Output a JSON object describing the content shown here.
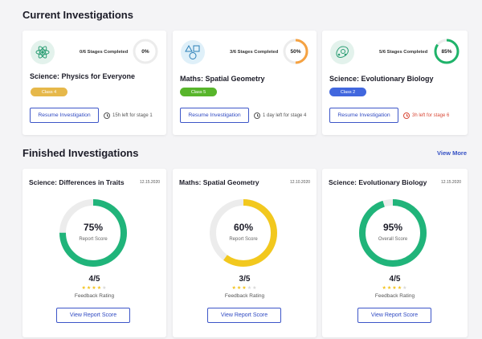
{
  "current": {
    "title": "Current Investigations",
    "cards": [
      {
        "icon": "atom-icon",
        "stages": "0/6 Stages Completed",
        "pct_label": "0%",
        "progress": 0,
        "title": "Science: Physics for Everyone",
        "badge": "Class 4",
        "badge_color": "#e6b84a",
        "ring_color": "#cfcfcf",
        "button": "Resume Investigation",
        "time_left": "15h left for stage 1",
        "time_color": "#555555"
      },
      {
        "icon": "shapes-icon",
        "stages": "3/6 Stages Completed",
        "pct_label": "50%",
        "progress": 50,
        "title": "Maths: Spatial Geometry",
        "badge": "Class 5",
        "badge_color": "#58b52b",
        "ring_color": "#f5a242",
        "button": "Resume Investigation",
        "time_left": "1 day left for stage 4",
        "time_color": "#555555"
      },
      {
        "icon": "cell-icon",
        "stages": "5/6 Stages Completed",
        "pct_label": "85%",
        "progress": 85,
        "title": "Science: Evolutionary Biology",
        "badge": "Class 2",
        "badge_color": "#4167de",
        "ring_color": "#1fb36a",
        "button": "Resume Investigation",
        "time_left": "3h left for stage 6",
        "time_color": "#d94a38"
      }
    ]
  },
  "finished": {
    "title": "Finished Investigations",
    "view_more": "View More",
    "cards": [
      {
        "title": "Science: Differences in Traits",
        "date": "12.15.2020",
        "pct_label": "75%",
        "progress": 75,
        "score_label": "Report Score",
        "ring_color": "#20b47a",
        "rating": "4/5",
        "stars": 4,
        "rating_label": "Feedback Rating",
        "button": "View Report Score"
      },
      {
        "title": "Maths: Spatial Geometry",
        "date": "12.10.2020",
        "pct_label": "60%",
        "progress": 60,
        "score_label": "Report Score",
        "ring_color": "#f2c81e",
        "rating": "3/5",
        "stars": 3,
        "rating_label": "Feedback Rating",
        "button": "View Report Score"
      },
      {
        "title": "Science: Evolutionary Biology",
        "date": "12.15.2020",
        "pct_label": "95%",
        "progress": 95,
        "score_label": "Overall Score",
        "ring_color": "#20b47a",
        "rating": "4/5",
        "stars": 4,
        "rating_label": "Feedback Rating",
        "button": "View Report Score"
      }
    ]
  }
}
